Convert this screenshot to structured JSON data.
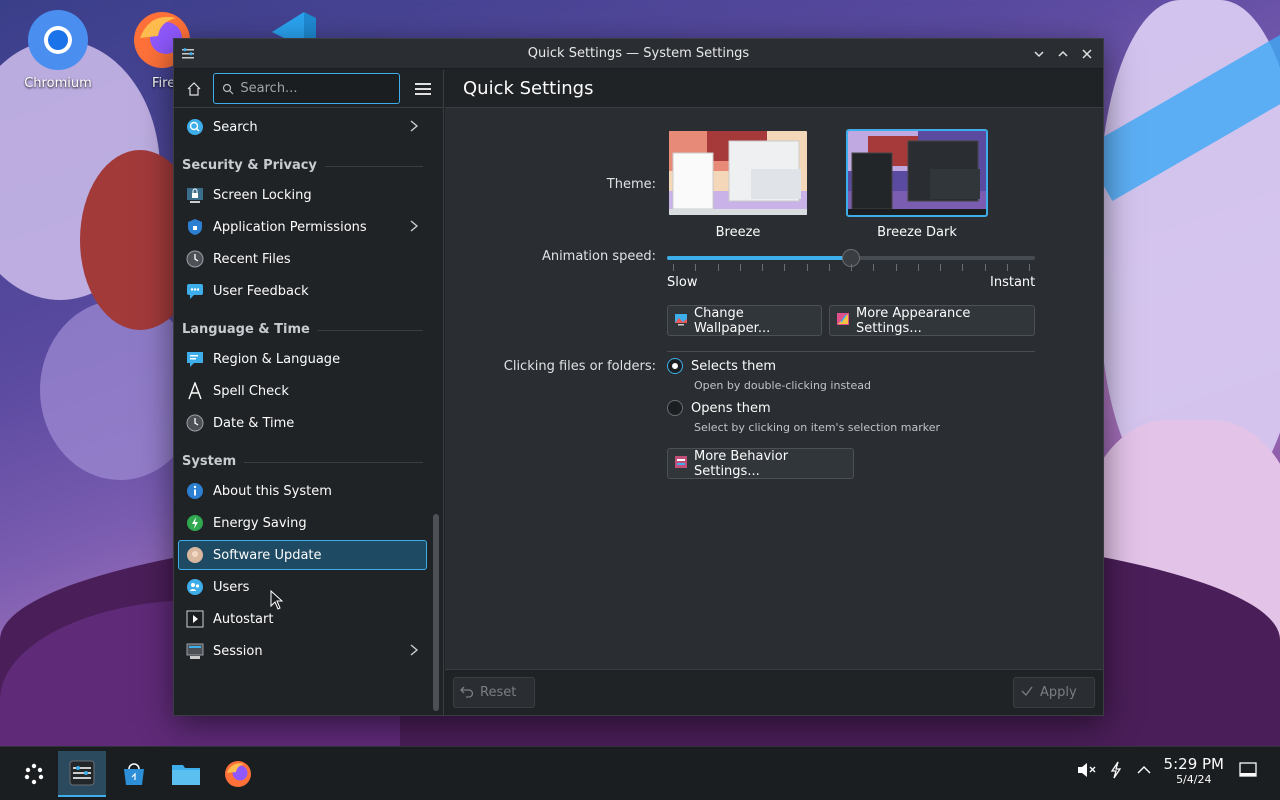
{
  "desktop": {
    "icons": [
      {
        "label": "Chromium",
        "icon": "chromium-icon"
      },
      {
        "label": "Fire",
        "icon": "firefox-icon"
      },
      {
        "label": "",
        "icon": "vscode-icon"
      }
    ]
  },
  "window": {
    "title": "Quick Settings — System Settings"
  },
  "sidebar": {
    "search_placeholder": "Search...",
    "items": [
      {
        "type": "item",
        "label": "Search",
        "icon": "search-settings-icon",
        "has_arrow": true
      },
      {
        "type": "section",
        "label": "Security & Privacy"
      },
      {
        "type": "item",
        "label": "Screen Locking",
        "icon": "screen-lock-icon"
      },
      {
        "type": "item",
        "label": "Application Permissions",
        "icon": "shield-icon",
        "has_arrow": true
      },
      {
        "type": "item",
        "label": "Recent Files",
        "icon": "clock-icon"
      },
      {
        "type": "item",
        "label": "User Feedback",
        "icon": "feedback-icon"
      },
      {
        "type": "section",
        "label": "Language & Time"
      },
      {
        "type": "item",
        "label": "Region & Language",
        "icon": "flag-icon"
      },
      {
        "type": "item",
        "label": "Spell Check",
        "icon": "spell-check-icon"
      },
      {
        "type": "item",
        "label": "Date & Time",
        "icon": "clock-icon"
      },
      {
        "type": "section",
        "label": "System"
      },
      {
        "type": "item",
        "label": "About this System",
        "icon": "info-icon"
      },
      {
        "type": "item",
        "label": "Energy Saving",
        "icon": "battery-icon"
      },
      {
        "type": "item",
        "label": "Software Update",
        "icon": "update-icon",
        "active": true
      },
      {
        "type": "item",
        "label": "Users",
        "icon": "users-icon"
      },
      {
        "type": "item",
        "label": "Autostart",
        "icon": "autostart-icon"
      },
      {
        "type": "item",
        "label": "Session",
        "icon": "session-icon",
        "has_arrow": true
      }
    ]
  },
  "main": {
    "title": "Quick Settings",
    "theme_label": "Theme:",
    "themes": [
      {
        "label": "Breeze",
        "selected": false
      },
      {
        "label": "Breeze Dark",
        "selected": true
      }
    ],
    "animation_label": "Animation speed:",
    "animation_value": 0.5,
    "slider_min_label": "Slow",
    "slider_max_label": "Instant",
    "change_wallpaper_label": "Change Wallpaper...",
    "more_appearance_label": "More Appearance Settings...",
    "clicking_label": "Clicking files or folders:",
    "radio_options": [
      {
        "label": "Selects them",
        "hint": "Open by double-clicking instead",
        "checked": true
      },
      {
        "label": "Opens them",
        "hint": "Select by clicking on item's selection marker",
        "checked": false
      }
    ],
    "more_behavior_label": "More Behavior Settings...",
    "reset_label": "Reset",
    "apply_label": "Apply"
  },
  "taskbar": {
    "clock_time": "5:29 PM",
    "clock_date": "5/4/24"
  },
  "colors": {
    "accent": "#3daee9",
    "window_bg": "#202326",
    "panel_bg": "#2a2e32"
  }
}
